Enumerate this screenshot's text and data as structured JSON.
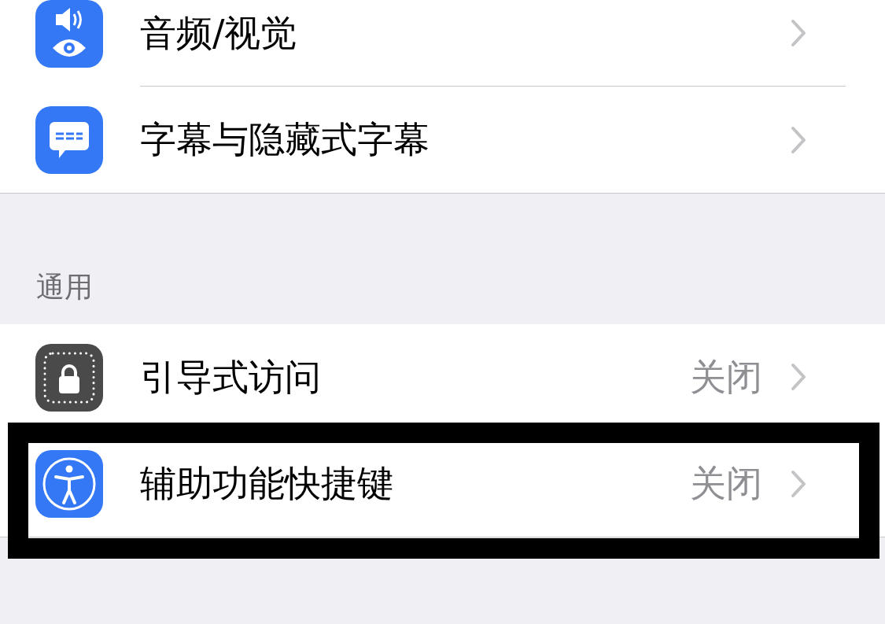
{
  "groups": [
    {
      "rows": [
        {
          "label": "音频/视觉",
          "highlighted": false
        },
        {
          "label": "字幕与隐藏式字幕",
          "highlighted": false
        }
      ]
    },
    {
      "header": "通用",
      "rows": [
        {
          "label": "引导式访问",
          "value": "关闭",
          "highlighted": false
        },
        {
          "label": "辅助功能快捷键",
          "value": "关闭",
          "highlighted": true
        }
      ]
    }
  ]
}
